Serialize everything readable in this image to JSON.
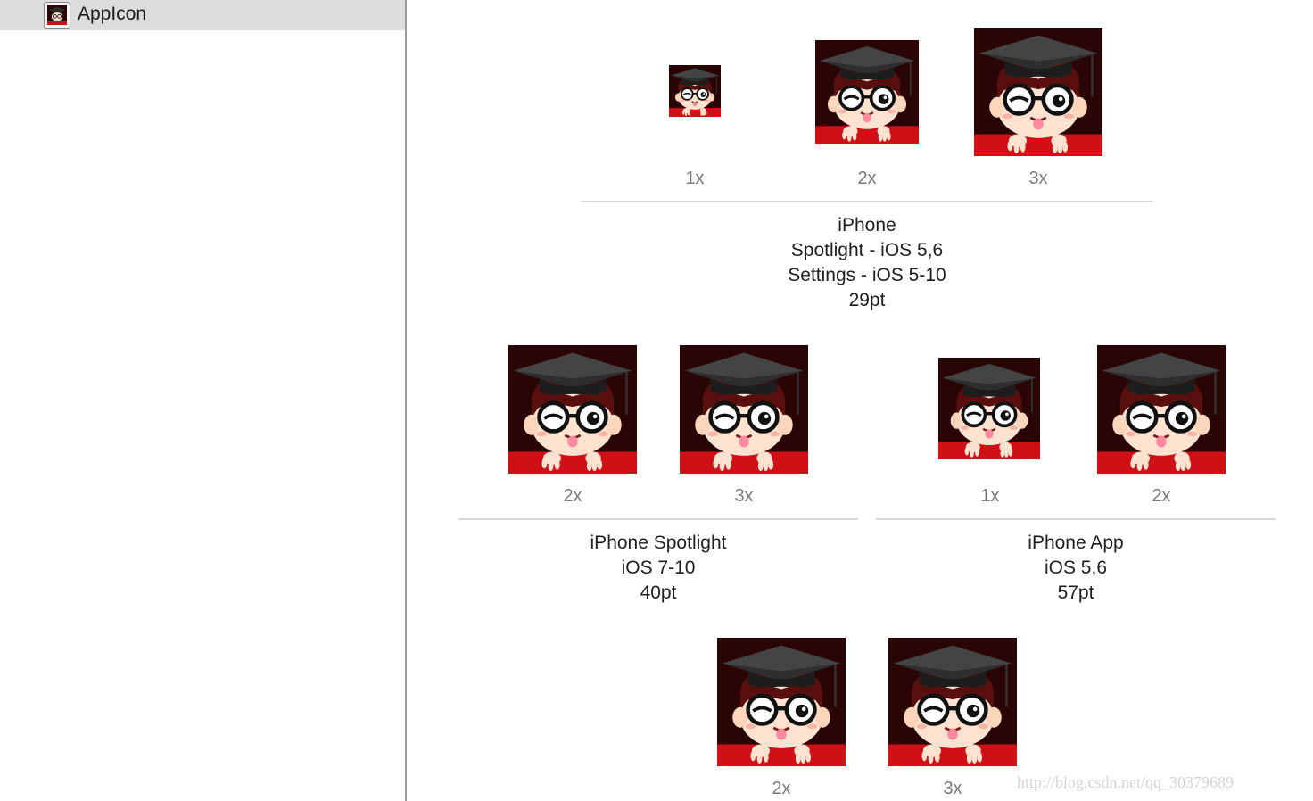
{
  "sidebar": {
    "items": [
      {
        "label": "AppIcon",
        "icon": "app-icon-thumbnail",
        "selected": true
      }
    ]
  },
  "groups": [
    {
      "lines": [
        "iPhone",
        "Spotlight - iOS 5,6",
        "Settings - iOS 5-10",
        "29pt"
      ],
      "slots": [
        "1x",
        "2x",
        "3x"
      ]
    },
    {
      "lines": [
        "iPhone Spotlight",
        "iOS 7-10",
        "40pt"
      ],
      "slots": [
        "2x",
        "3x"
      ]
    },
    {
      "lines": [
        "iPhone App",
        "iOS 5,6",
        "57pt"
      ],
      "slots": [
        "1x",
        "2x"
      ]
    },
    {
      "lines": [],
      "slots": [
        "2x",
        "3x"
      ]
    }
  ],
  "watermark": "http://blog.csdn.net/qq_30379689",
  "colors": {
    "sidebar_selected": "#dcdcdc",
    "separator": "#d9d9d9",
    "icon_bg_dark": "#2a0505",
    "icon_bg_red": "#d01016"
  }
}
